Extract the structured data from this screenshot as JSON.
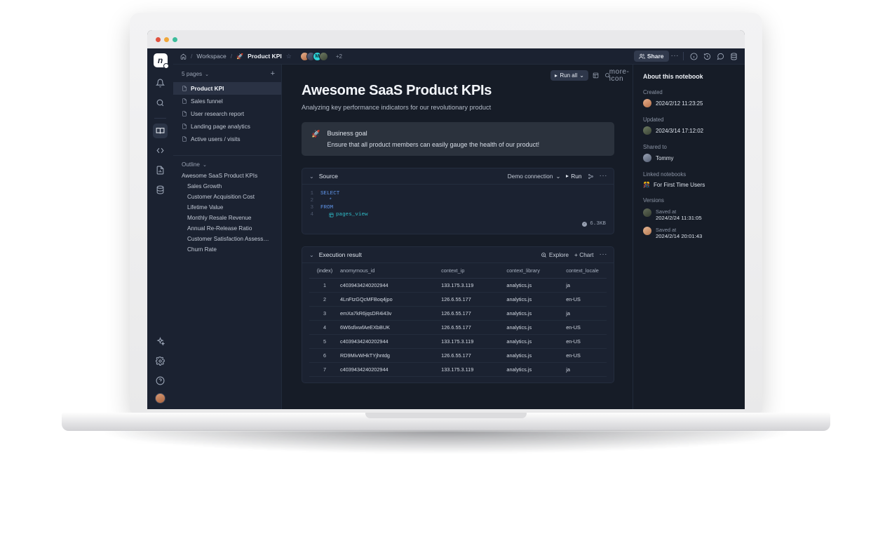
{
  "rail": {
    "logo": "n",
    "icons": [
      {
        "name": "bell-icon",
        "label": "Notifications"
      },
      {
        "name": "search-icon",
        "label": "Search"
      },
      {
        "name": "notebook-icon",
        "label": "Notebooks",
        "active": true
      },
      {
        "name": "code-icon",
        "label": "Code"
      },
      {
        "name": "file-icon",
        "label": "Files"
      },
      {
        "name": "database-icon",
        "label": "Data sources"
      }
    ],
    "bottom_icons": [
      {
        "name": "sparkle-icon",
        "label": "AI assistant"
      },
      {
        "name": "gear-icon",
        "label": "Settings"
      },
      {
        "name": "help-icon",
        "label": "Help"
      }
    ],
    "avatar": "user-avatar"
  },
  "topbar": {
    "home": "home-icon",
    "separator": "/",
    "workspace": "Workspace",
    "page_emoji": "🚀",
    "page": "Product KPI",
    "star": "☆",
    "avatars": [
      "user-1",
      "user-2",
      "M",
      "user-4"
    ],
    "overflow_count": "+2",
    "share_label": "Share",
    "more": "···",
    "icons": [
      {
        "name": "info-icon"
      },
      {
        "name": "history-icon"
      },
      {
        "name": "comment-icon"
      },
      {
        "name": "database-icon"
      }
    ]
  },
  "sidebar": {
    "pages_header": "5 pages",
    "chevron": "⌄",
    "add": "+",
    "pages": [
      {
        "label": "Product KPI",
        "selected": true
      },
      {
        "label": "Sales funnel",
        "selected": false
      },
      {
        "label": "User research report",
        "selected": false
      },
      {
        "label": "Landing page analytics",
        "selected": false
      },
      {
        "label": "Active users / visits",
        "selected": false
      }
    ],
    "outline_header": "Outline",
    "outline": [
      {
        "label": "Awesome SaaS Product KPIs",
        "level": 1
      },
      {
        "label": "Sales Growth",
        "level": 2
      },
      {
        "label": "Customer Acquisition Cost",
        "level": 2
      },
      {
        "label": "Lifetime Value",
        "level": 2
      },
      {
        "label": "Monthly Resale Revenue",
        "level": 2
      },
      {
        "label": "Annual Re-Release Ratio",
        "level": 2
      },
      {
        "label": "Customer Satisfaction Assessm…",
        "level": 2
      },
      {
        "label": "Churn Rate",
        "level": 2
      }
    ]
  },
  "canvas_tools": {
    "run_all": "Run all",
    "chevron": "⌄",
    "icons": [
      {
        "name": "layout-icon"
      },
      {
        "name": "search-icon"
      },
      {
        "name": "more-icon"
      }
    ]
  },
  "doc": {
    "title": "Awesome SaaS Product KPIs",
    "subtitle": "Analyzing key performance indicators for our revolutionary product",
    "callout": {
      "emoji": "🚀",
      "title": "Business goal",
      "text": "Ensure that all product members can easily gauge the health of our product!"
    }
  },
  "source_block": {
    "chevron": "⌄",
    "title": "Source",
    "connection": "Demo connection",
    "connection_chevron": "⌄",
    "run_label": "Run",
    "lineage_icon": "lineage-icon",
    "more": "···",
    "code_lines": [
      {
        "num": "1",
        "indent": 0,
        "tokens": [
          {
            "t": "SELECT",
            "k": "kw"
          }
        ]
      },
      {
        "num": "2",
        "indent": 1,
        "tokens": [
          {
            "t": "*",
            "k": "star"
          }
        ]
      },
      {
        "num": "3",
        "indent": 0,
        "tokens": [
          {
            "t": "FROM",
            "k": "kw"
          }
        ]
      },
      {
        "num": "4",
        "indent": 1,
        "tokens": [
          {
            "t": "pages_view",
            "k": "table"
          }
        ]
      }
    ],
    "size": "6.3KB"
  },
  "result_block": {
    "chevron": "⌄",
    "title": "Execution result",
    "explore_label": "Explore",
    "chart_label": "+ Chart",
    "more": "···",
    "columns": [
      "(index)",
      "anomymous_id",
      "context_ip",
      "context_library",
      "context_locale"
    ],
    "rows": [
      [
        "1",
        "c4039434240202944",
        "133.175.3.119",
        "analytics.js",
        "ja"
      ],
      [
        "2",
        "4LnFtzGQcMFBoq4jpo",
        "126.6.55.177",
        "analytics.js",
        "en-US"
      ],
      [
        "3",
        "emXa7kR6jqsDR4i43v",
        "126.6.55.177",
        "analytics.js",
        "ja"
      ],
      [
        "4",
        "6W6sfixwfAeEXbBUK",
        "126.6.55.177",
        "analytics.js",
        "en-US"
      ],
      [
        "5",
        "c4039434240202944",
        "133.175.3.119",
        "analytics.js",
        "en-US"
      ],
      [
        "6",
        "RD9MivWHkTYjhntdg",
        "126.6.55.177",
        "analytics.js",
        "en-US"
      ],
      [
        "7",
        "c4039434240202944",
        "133.175.3.119",
        "analytics.js",
        "ja"
      ]
    ]
  },
  "aside": {
    "title": "About this notebook",
    "created_label": "Created",
    "created_value": "2024/2/12 11:23:25",
    "updated_label": "Updated",
    "updated_value": "2024/3/14 17:12:02",
    "shared_label": "Shared to",
    "shared_value": "Tommy",
    "linked_label": "Linked notebooks",
    "linked_emoji": "🎊",
    "linked_value": "For First Time Users",
    "versions_label": "Versions",
    "versions": [
      {
        "saved_label": "Saved at",
        "value": "2024/2/24 11:31:05"
      },
      {
        "saved_label": "Saved at",
        "value": "2024/2/14 20:01:43"
      }
    ]
  },
  "colors": {
    "app_bg": "#161c27",
    "panel_bg": "#1b2231",
    "selected": "#2a3244",
    "callout_bg": "#2b323d",
    "accent_keyword": "#5f94e8",
    "accent_table": "#2fb8c4",
    "share_bg": "#313a4d"
  }
}
